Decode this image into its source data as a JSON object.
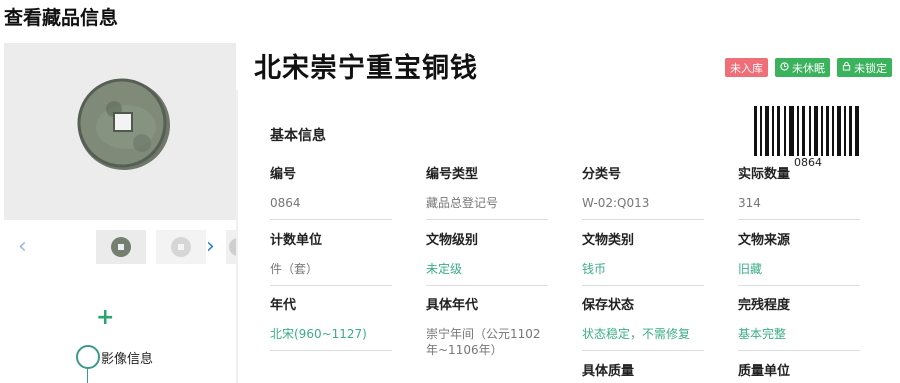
{
  "page": {
    "title": "查看藏品信息"
  },
  "object": {
    "title": "北宋崇宁重宝铜钱"
  },
  "badges": [
    {
      "label": "未入库",
      "color": "#ef6f78"
    },
    {
      "label": "未休眠",
      "icon": "clock-icon",
      "color": "#3bb35c"
    },
    {
      "label": "未锁定",
      "icon": "lock-icon",
      "color": "#3bb35c"
    }
  ],
  "gallery": {
    "prev_icon": "chevron-left-icon",
    "next_icon": "chevron-right-icon"
  },
  "timeline": {
    "add_icon": "plus-icon",
    "items": [
      {
        "label": "影像信息"
      }
    ]
  },
  "barcode": {
    "number": "0864"
  },
  "section": {
    "title": "基本信息"
  },
  "fields": [
    {
      "label": "编号",
      "value": "0864"
    },
    {
      "label": "编号类型",
      "value": "藏品总登记号"
    },
    {
      "label": "分类号",
      "value": "W-02:Q013"
    },
    {
      "label": "实际数量",
      "value": "314"
    },
    {
      "label": "计数单位",
      "value": "件（套）"
    },
    {
      "label": "文物级别",
      "value": "未定级"
    },
    {
      "label": "文物类别",
      "value": "钱币"
    },
    {
      "label": "文物来源",
      "value": "旧藏"
    },
    {
      "label": "年代",
      "value": "北宋(960~1127)"
    },
    {
      "label": "具体年代",
      "value": "崇宁年间（公元1102年~1106年）"
    },
    {
      "label": "保存状态",
      "value": "状态稳定，不需修复"
    },
    {
      "label": "完残程度",
      "value": "基本完整"
    },
    {
      "label": "具体质量",
      "value": ""
    },
    {
      "label": "质量单位",
      "value": ""
    }
  ],
  "colors": {
    "link": "#3cae86",
    "label": "#222222",
    "muted": "#777777"
  }
}
